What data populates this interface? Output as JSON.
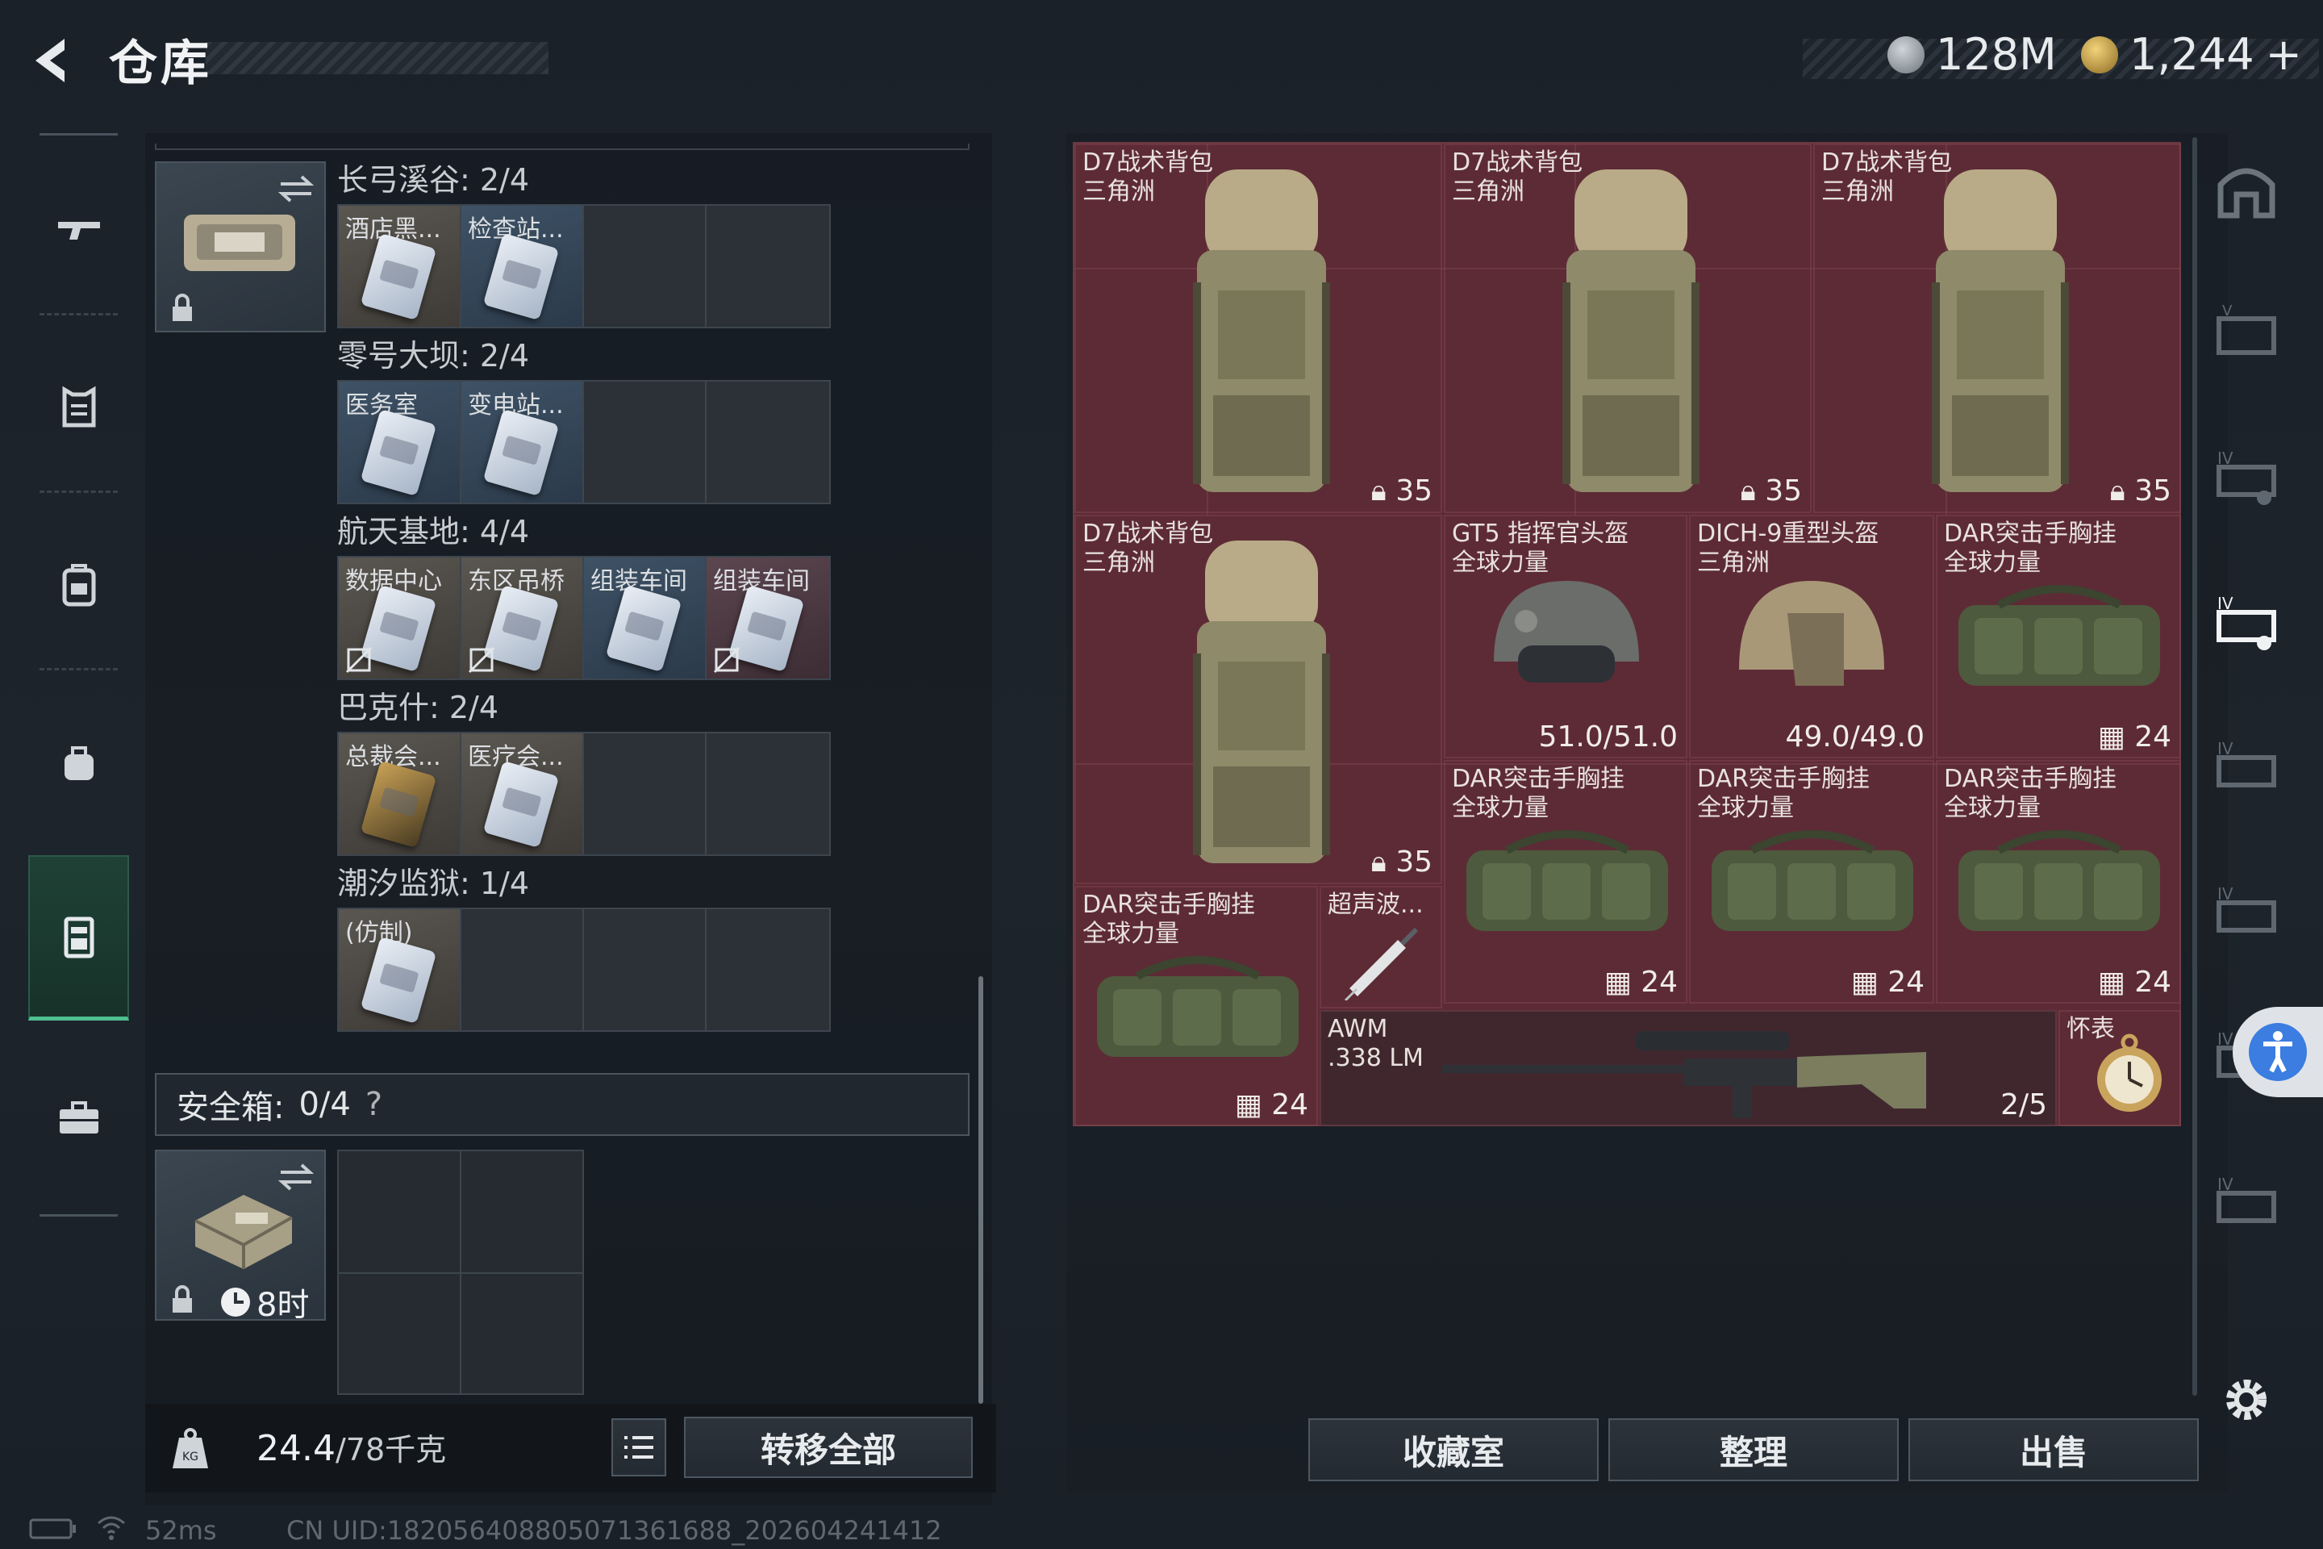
{
  "header": {
    "title": "仓库",
    "currency_silver": "128M",
    "currency_gold": "1,244",
    "add_label": "+"
  },
  "colors": {
    "grid_bg": "#5d2b35",
    "accent_green": "#4fbf8f",
    "access_blue": "#3b7de0"
  },
  "left_nav": [
    "weapon-icon",
    "armor-icon",
    "backpack-icon",
    "bag-icon",
    "card-case-icon",
    "toolbox-icon"
  ],
  "card_case": {
    "groups": [
      {
        "label": "长弓溪谷: 2/4",
        "slots": [
          "酒店黑...",
          "检查站...",
          "",
          ""
        ]
      },
      {
        "label": "零号大坝: 2/4",
        "slots": [
          "医务室",
          "变电站...",
          "",
          ""
        ]
      },
      {
        "label": "航天基地: 4/4",
        "slots": [
          "数据中心",
          "东区吊桥",
          "组装车间",
          "组装车间"
        ]
      },
      {
        "label": "巴克什: 2/4",
        "slots": [
          "总裁会...",
          "医疗会...",
          "",
          ""
        ]
      },
      {
        "label": "潮汐监狱: 1/4",
        "slots": [
          "(仿制)",
          "",
          "",
          ""
        ]
      }
    ]
  },
  "safe_box": {
    "label": "安全箱:",
    "count": "0/4",
    "help": "?",
    "timer": "8时"
  },
  "weight": {
    "current": "24.4",
    "max": "/78千克",
    "transfer_all": "转移全部"
  },
  "items": [
    {
      "name": "D7战术背包\n三角洲",
      "value": "35"
    },
    {
      "name": "D7战术背包\n三角洲",
      "value": "35"
    },
    {
      "name": "D7战术背包\n三角洲",
      "value": "35"
    },
    {
      "name": "D7战术背包\n三角洲",
      "value": "35"
    },
    {
      "name": "GT5 指挥官头盔\n全球力量",
      "value": "51.0/51.0"
    },
    {
      "name": "DICH-9重型头盔\n三角洲",
      "value": "49.0/49.0"
    },
    {
      "name": "DAR突击手胸挂\n全球力量",
      "value": "24"
    },
    {
      "name": "DAR突击手胸挂\n全球力量",
      "value": "24"
    },
    {
      "name": "DAR突击手胸挂\n全球力量",
      "value": "24"
    },
    {
      "name": "DAR突击手胸挂\n全球力量",
      "value": "24"
    },
    {
      "name": "DAR突击手胸挂\n全球力量",
      "value": "24"
    },
    {
      "name": "超声波...",
      "value": ""
    },
    {
      "name": "AWM\n.338 LM",
      "value": "2/5"
    },
    {
      "name": "怀表",
      "value": ""
    }
  ],
  "actions": {
    "collection": "收藏室",
    "sort": "整理",
    "sell": "出售"
  },
  "footer": {
    "ping": "52ms",
    "uid": "CN UID:1820564088050713616​88_202604241412"
  }
}
